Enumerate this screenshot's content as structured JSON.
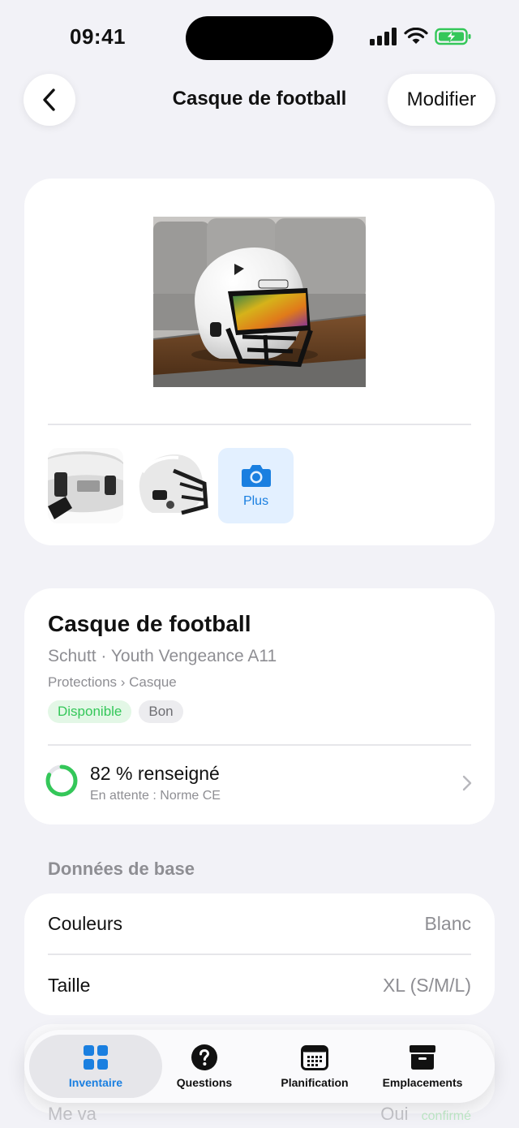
{
  "status": {
    "time": "09:41"
  },
  "nav": {
    "title": "Casque de football",
    "edit_label": "Modifier"
  },
  "photos": {
    "add_label": "Plus"
  },
  "item": {
    "title": "Casque de football",
    "brand_model": "Schutt · Youth Vengeance A11",
    "category_path": "Protections › Casque",
    "availability": "Disponible",
    "condition": "Bon",
    "completion_text": "82 % renseigné",
    "completion_value": 82,
    "pending_text": "En attente : Norme CE"
  },
  "section": {
    "title": "Données de base"
  },
  "fields": [
    {
      "label": "Couleurs",
      "value": "Blanc"
    },
    {
      "label": "Taille",
      "value": "XL (S/M/L)"
    }
  ],
  "peek": {
    "label": "Me va",
    "value": "Oui",
    "badge": "confirmé"
  },
  "tabs": [
    {
      "label": "Inventaire",
      "icon": "grid-icon",
      "active": true
    },
    {
      "label": "Questions",
      "icon": "question-icon",
      "active": false
    },
    {
      "label": "Planification",
      "icon": "calendar-icon",
      "active": false
    },
    {
      "label": "Emplacements",
      "icon": "archive-box-icon",
      "active": false
    }
  ],
  "colors": {
    "accent": "#1a7fe0",
    "success": "#34c759",
    "background": "#f2f2f7"
  }
}
